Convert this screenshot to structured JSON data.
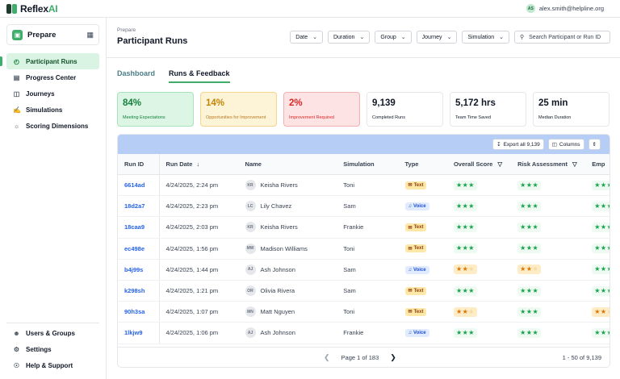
{
  "app": {
    "brand_a": "Reflex",
    "brand_b": "AI",
    "user_initials": "AS",
    "user_email": "alex.smith@helpline.org"
  },
  "sidebar": {
    "project": "Prepare",
    "items": [
      {
        "label": "Participant Runs",
        "icon": "clock-icon",
        "active": true
      },
      {
        "label": "Progress Center",
        "icon": "chart-icon"
      },
      {
        "label": "Journeys",
        "icon": "map-icon"
      },
      {
        "label": "Simulations",
        "icon": "chat-icon"
      },
      {
        "label": "Scoring Dimensions",
        "icon": "bulb-icon"
      }
    ],
    "bottom": [
      {
        "label": "Users & Groups",
        "icon": "users-icon"
      },
      {
        "label": "Settings",
        "icon": "gear-icon"
      },
      {
        "label": "Help & Support",
        "icon": "help-icon"
      }
    ]
  },
  "header": {
    "crumb": "Prepare",
    "title": "Participant Runs",
    "filters": [
      "Date",
      "Duration",
      "Group",
      "Journey",
      "Simulation"
    ],
    "search_placeholder": "Search Participant or Run ID"
  },
  "tabs": [
    "Dashboard",
    "Runs & Feedback"
  ],
  "stats": [
    {
      "value": "84%",
      "label": "Meeting Expectations"
    },
    {
      "value": "14%",
      "label": "Opportunities for Improvement"
    },
    {
      "value": "2%",
      "label": "Improvement Required"
    },
    {
      "value": "9,139",
      "label": "Completed Runs"
    },
    {
      "value": "5,172 hrs",
      "label": "Team Time Saved"
    },
    {
      "value": "25 min",
      "label": "Median Duration"
    }
  ],
  "toolbar": {
    "export": "Export all 9,139",
    "columns": "Columns"
  },
  "columns": {
    "id": "Run ID",
    "date": "Run Date",
    "name": "Name",
    "sim": "Simulation",
    "type": "Type",
    "score": "Overall Score",
    "risk": "Risk Assessment",
    "emp": "Emp"
  },
  "rows": [
    {
      "id": "6614ad",
      "date": "4/24/2025, 2:24 pm",
      "initials": "KR",
      "name": "Keisha Rivers",
      "sim": "Toni",
      "type": "Text",
      "score": 3,
      "risk": 3,
      "emp": 3
    },
    {
      "id": "18d2a7",
      "date": "4/24/2025, 2:23 pm",
      "initials": "LC",
      "name": "Lily Chavez",
      "sim": "Sam",
      "type": "Voice",
      "score": 3,
      "risk": 3,
      "emp": 3
    },
    {
      "id": "18caa9",
      "date": "4/24/2025, 2:03 pm",
      "initials": "KR",
      "name": "Keisha Rivers",
      "sim": "Frankie",
      "type": "Text",
      "score": 3,
      "risk": 3,
      "emp": 3
    },
    {
      "id": "ec498e",
      "date": "4/24/2025, 1:56 pm",
      "initials": "MW",
      "name": "Madison Williams",
      "sim": "Toni",
      "type": "Text",
      "score": 3,
      "risk": 3,
      "emp": 3
    },
    {
      "id": "b4j99s",
      "date": "4/24/2025, 1:44 pm",
      "initials": "AJ",
      "name": "Ash Johnson",
      "sim": "Sam",
      "type": "Voice",
      "score": 2,
      "risk": 2,
      "emp": 3
    },
    {
      "id": "k298sh",
      "date": "4/24/2025, 1:21 pm",
      "initials": "OR",
      "name": "Olivia Rivera",
      "sim": "Sam",
      "type": "Text",
      "score": 3,
      "risk": 3,
      "emp": 3
    },
    {
      "id": "90h3sa",
      "date": "4/24/2025, 1:07 pm",
      "initials": "MN",
      "name": "Matt Nguyen",
      "sim": "Toni",
      "type": "Text",
      "score": 2,
      "risk": 3,
      "emp": 2
    },
    {
      "id": "1lkjw9",
      "date": "4/24/2025, 1:06 pm",
      "initials": "AJ",
      "name": "Ash Johnson",
      "sim": "Frankie",
      "type": "Voice",
      "score": 3,
      "risk": 3,
      "emp": 3
    }
  ],
  "pagination": {
    "label": "Page 1 of 183",
    "range": "1 - 50 of 9,139"
  }
}
